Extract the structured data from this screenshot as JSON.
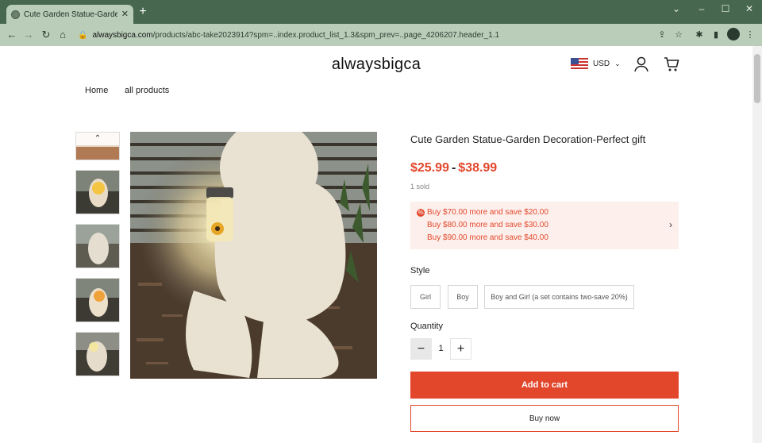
{
  "browser": {
    "tab_title": "Cute Garden Statue-Garden Dec",
    "url_host": "alwaysbigca.com",
    "url_path": "/products/abc-take2023914?spm=..index.product_list_1.3&spm_prev=..page_4206207.header_1.1"
  },
  "store": {
    "logo": "alwaysbigca",
    "currency": "USD",
    "nav": [
      "Home",
      "all products"
    ]
  },
  "product": {
    "title": "Cute Garden Statue-Garden Decoration-Perfect gift",
    "price_low": "$25.99",
    "price_sep": "-",
    "price_high": "$38.99",
    "sold": "1 sold",
    "promo": [
      "Buy $70.00 more and save $20.00",
      "Buy $80.00 more and save $30.00",
      "Buy $90.00 more and save $40.00"
    ],
    "style_label": "Style",
    "styles": [
      "Girl",
      "Boy",
      "Boy and Girl (a set contains two-save 20%)"
    ],
    "quantity_label": "Quantity",
    "quantity": "1",
    "add_to_cart": "Add to cart",
    "buy_now": "Buy now"
  },
  "colors": {
    "accent": "#e2472c",
    "chrome": "#47684e"
  }
}
